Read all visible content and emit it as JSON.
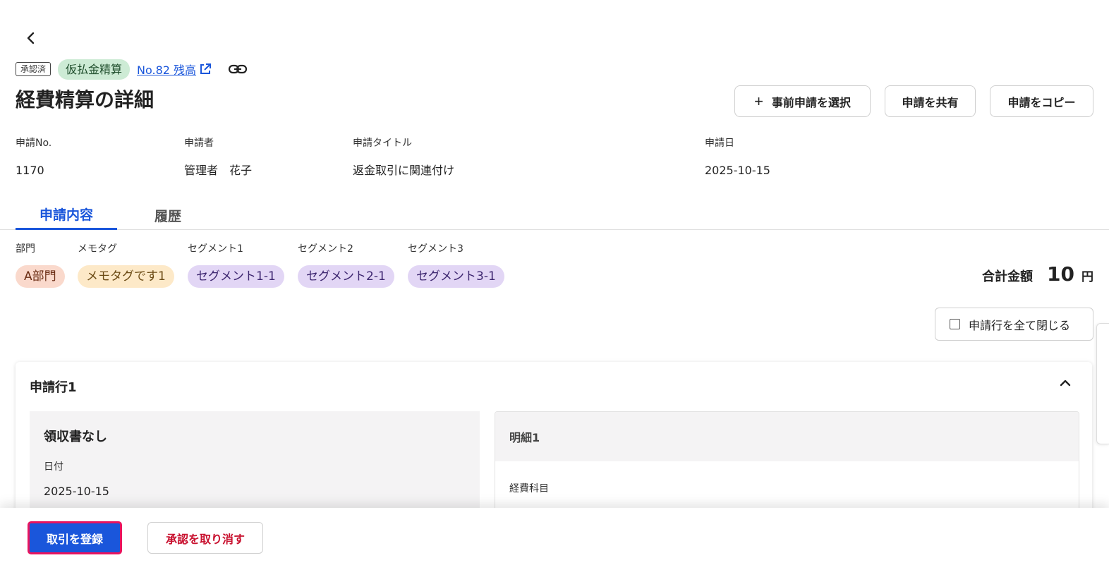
{
  "header": {
    "status_badge": "承認済",
    "type_badge": "仮払金精算",
    "ref_link": "No.82 残高",
    "title": "経費精算の詳細"
  },
  "actions": {
    "select_pre_request": "事前申請を選択",
    "share": "申請を共有",
    "copy": "申請をコピー"
  },
  "meta": [
    {
      "label": "申請No.",
      "value": "1170"
    },
    {
      "label": "申請者",
      "value": "管理者　花子"
    },
    {
      "label": "申請タイトル",
      "value": "返金取引に関連付け"
    },
    {
      "label": "申請日",
      "value": "2025-10-15"
    }
  ],
  "tabs": [
    {
      "label": "申請内容",
      "active": true
    },
    {
      "label": "履歴",
      "active": false
    }
  ],
  "tags": [
    {
      "label": "部門",
      "value": "A部門",
      "bg": "#fad9cc",
      "fg": "#6b2d14"
    },
    {
      "label": "メモタグ",
      "value": "メモタグです1",
      "bg": "#fde9c8",
      "fg": "#6b4a14"
    },
    {
      "label": "セグメント1",
      "value": "セグメント1-1",
      "bg": "#e2d6f5",
      "fg": "#3d2670"
    },
    {
      "label": "セグメント2",
      "value": "セグメント2-1",
      "bg": "#e2d6f5",
      "fg": "#3d2670"
    },
    {
      "label": "セグメント3",
      "value": "セグメント3-1",
      "bg": "#e2d6f5",
      "fg": "#3d2670"
    }
  ],
  "total": {
    "label": "合計金額",
    "amount": "10",
    "unit": "円"
  },
  "collapse_all_label": "申請行を全て閉じる",
  "row": {
    "title": "申請行1",
    "receipt": "領収書なし",
    "date_label": "日付",
    "date_value": "2025-10-15",
    "detail_title": "明細1",
    "expense_account_label": "経費科目"
  },
  "footer": {
    "register": "取引を登録",
    "revoke": "承認を取り消す"
  },
  "colors": {
    "accent": "#1a56db",
    "danger": "#c8102e",
    "focus_ring": "#e8145f"
  }
}
